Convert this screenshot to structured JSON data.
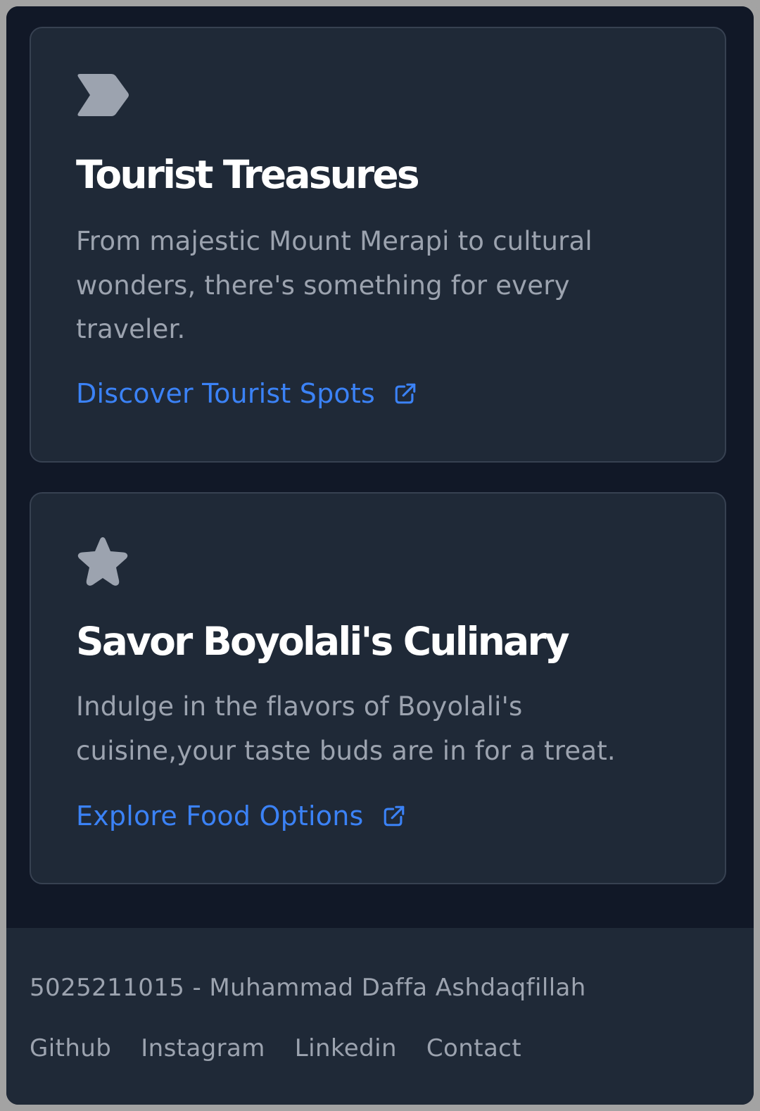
{
  "cards": [
    {
      "icon": "chevron-tag-icon",
      "title": "Tourist Treasures",
      "description": "From majestic Mount Merapi to cultural wonders, there's something for every traveler.",
      "link_label": "Discover Tourist Spots",
      "link_icon": "external-link-icon"
    },
    {
      "icon": "star-icon",
      "title": "Savor Boyolali's Culinary",
      "description": "Indulge in the flavors of Boyolali's cuisine,your taste buds are in for a treat.",
      "link_label": "Explore Food Options",
      "link_icon": "external-link-icon"
    }
  ],
  "footer": {
    "credit": "5025211015 - Muhammad Daffa Ashdaqfillah",
    "links": [
      "Github",
      "Instagram",
      "Linkedin",
      "Contact"
    ]
  },
  "colors": {
    "page_background": "#111827",
    "card_background": "#1f2937",
    "card_border": "#374151",
    "title": "#ffffff",
    "muted_text": "#9ca3af",
    "link": "#3b82f6",
    "frame": "#a3a3a3"
  }
}
